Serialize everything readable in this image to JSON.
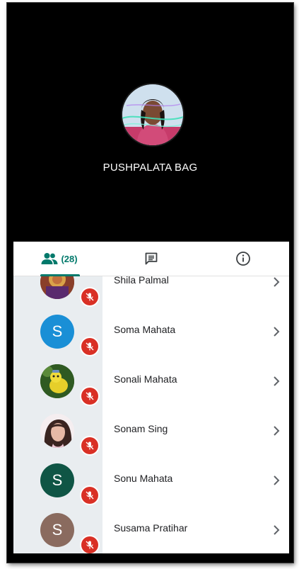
{
  "speaker": {
    "name": "PUSHPALATA BAG"
  },
  "tabs": {
    "people_count": "(28)",
    "accent_color": "#00796b"
  },
  "participants": [
    {
      "name": "Shila Palmal",
      "initial": "",
      "avatar_type": "photo-idol",
      "muted": true
    },
    {
      "name": "Soma Mahata",
      "initial": "S",
      "avatar_color": "#1a8fd6",
      "muted": true
    },
    {
      "name": "Sonali Mahata",
      "initial": "",
      "avatar_type": "photo-toy",
      "muted": true
    },
    {
      "name": "Sonam Sing",
      "initial": "",
      "avatar_type": "photo-girl",
      "muted": true
    },
    {
      "name": "Sonu Mahata",
      "initial": "S",
      "avatar_color": "#0f5545",
      "muted": true
    },
    {
      "name": "Susama Pratihar",
      "initial": "S",
      "avatar_color": "#8a6b5f",
      "muted": true
    }
  ],
  "icons": {
    "people_tab": "people-icon",
    "chat_tab": "chat-icon",
    "info_tab": "info-icon",
    "mute": "mic-off-icon",
    "row_arrow": "chevron-right-icon"
  }
}
